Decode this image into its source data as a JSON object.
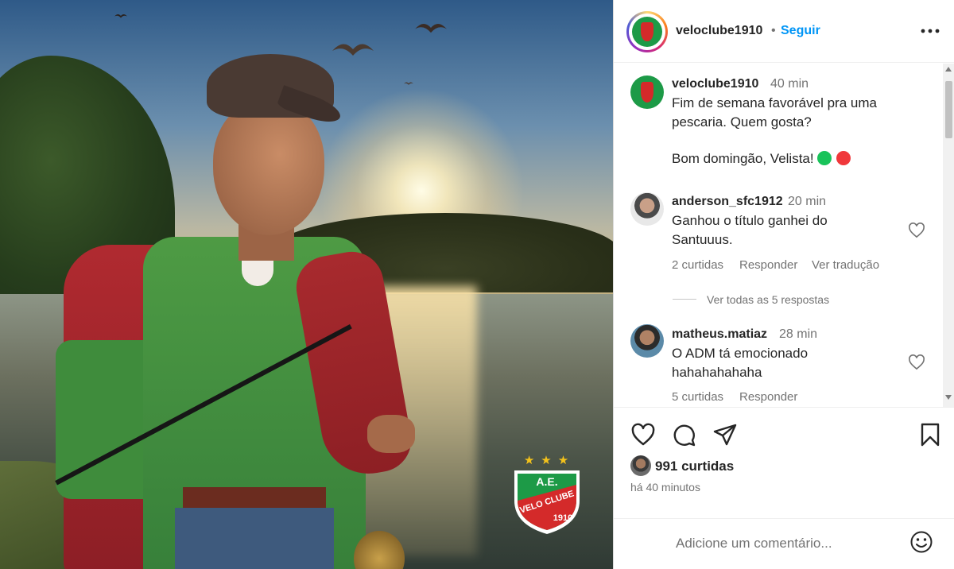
{
  "post": {
    "username": "veloclube1910",
    "follow_label": "Seguir",
    "separator": "•",
    "badge": {
      "stars": "★★★",
      "line1": "A.E.",
      "line2": "VELO CLUBE",
      "line3": "1910"
    }
  },
  "caption": {
    "username": "veloclube1910",
    "time": "40 min",
    "line1": "Fim de semana favorável pra uma",
    "line2": "pescaria. Quem gosta?",
    "line3": "Bom domingão, Velista!"
  },
  "comments": [
    {
      "username": "anderson_sfc1912",
      "time": "20 min",
      "line1": "Ganhou o título ganhei do",
      "line2": "Santuuus.",
      "likes": "2 curtidas",
      "reply": "Responder",
      "translate": "Ver tradução",
      "view_replies": "Ver todas as 5 respostas"
    },
    {
      "username": "matheus.matiaz",
      "time": "28 min",
      "line1": "O ADM tá emocionado",
      "line2": "hahahahahaha",
      "likes": "5 curtidas",
      "reply": "Responder"
    }
  ],
  "stats": {
    "likes": "991 curtidas",
    "posted": "há 40 minutos"
  },
  "add_comment": {
    "placeholder": "Adicione um comentário..."
  },
  "colors": {
    "follow_blue": "#0095f6",
    "club_green": "#1d9a47",
    "club_red": "#d42a2a",
    "emoji_green": "#19c35a",
    "emoji_red": "#f0383b"
  },
  "icons": [
    "more-icon",
    "heart-icon",
    "comment-icon",
    "share-icon",
    "bookmark-icon",
    "emoji-icon"
  ]
}
